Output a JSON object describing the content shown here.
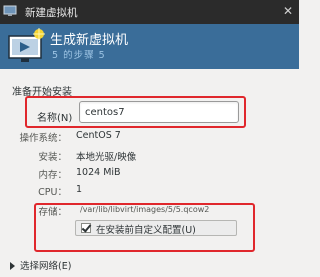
{
  "window": {
    "title": "新建虚拟机",
    "icon": "vm-window-icon",
    "close_icon": "close-icon"
  },
  "banner": {
    "title": "生成新虚拟机",
    "step": "5 的步骤 5",
    "icon": "vm-monitor-icon",
    "color": "#3a6d99"
  },
  "section_heading": "准备开始安装",
  "name": {
    "label": "名称(N)",
    "value": "centos7"
  },
  "details": [
    {
      "label": "操作系统：",
      "value": "CentOS 7"
    },
    {
      "label": "安装：",
      "value": "本地光驱/映像"
    },
    {
      "label": "内存：",
      "value": "1024 MiB"
    },
    {
      "label": "CPU：",
      "value": "1"
    }
  ],
  "storage": {
    "label": "存储：",
    "path": "/var/lib/libvirt/images/5/5.qcow2",
    "customize_label": "在安装前自定义配置(U)",
    "customize_checked": true
  },
  "network": {
    "label": "选择网络(E)"
  },
  "highlight_color": "#e0272c"
}
